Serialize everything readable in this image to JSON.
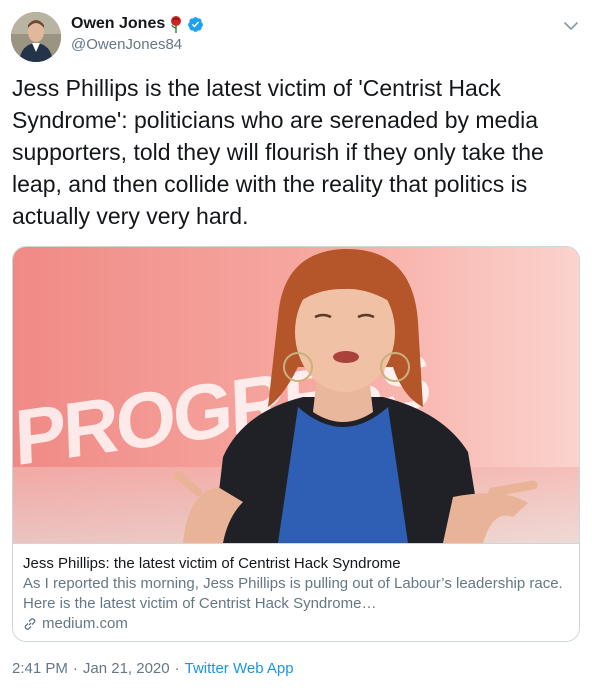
{
  "author": {
    "display_name": "Owen Jones",
    "handle": "@OwenJones84"
  },
  "tweet": {
    "text": "Jess Phillips is the latest victim of 'Centrist Hack Syndrome': politicians who are serenaded by media supporters, told they will flourish if they only take the leap, and then collide with the reality that politics is actually very very hard."
  },
  "card": {
    "image_sign_text": "PROGRESS",
    "title": "Jess Phillips: the latest victim of Centrist Hack Syndrome",
    "description": "As I reported this morning, Jess Phillips is pulling out of Labour’s leadership race. Here is the latest victim of Centrist Hack Syndrome…",
    "domain": "medium.com"
  },
  "footer": {
    "time": "2:41 PM",
    "separator": "·",
    "date": "Jan 21, 2020",
    "separator2": "·",
    "source": "Twitter Web App"
  },
  "colors": {
    "link": "#1b95e0",
    "verified": "#1da1f2",
    "secondary_text": "#657786"
  },
  "icons": [
    "rose-icon",
    "verified-icon",
    "chevron-down-icon",
    "link-icon"
  ]
}
